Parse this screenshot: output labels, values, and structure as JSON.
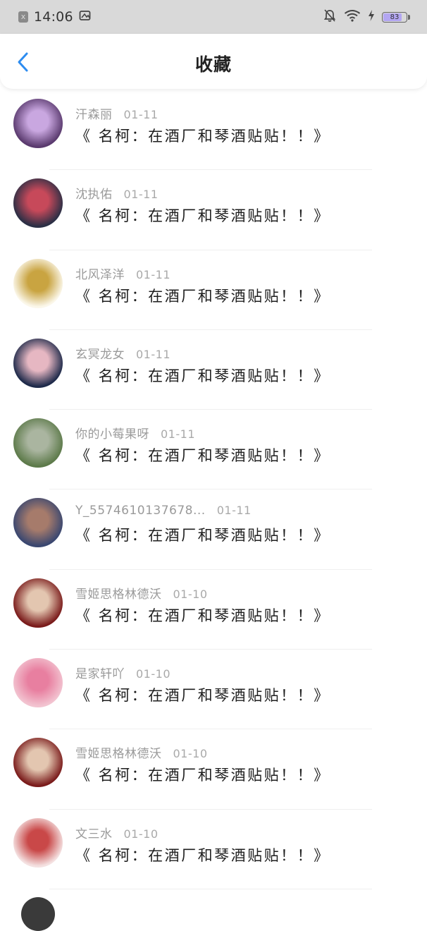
{
  "status_bar": {
    "time": "14:06",
    "sim_icon": "x",
    "battery": "83",
    "battery_fraction": 0.83,
    "icons": [
      "close-box-icon",
      "screenshot-icon",
      "bell-off-icon",
      "wifi-icon",
      "charging-icon",
      "battery-icon"
    ]
  },
  "header": {
    "title": "收藏",
    "back_icon": "chevron-left-icon",
    "accent": "#2d8cf0"
  },
  "items": [
    {
      "user": "汗森丽",
      "date": "01-11",
      "title": "《 名柯：在酒厂和琴酒贴贴！！》",
      "avatar": [
        "#5a3a6e",
        "#c9a7e0"
      ]
    },
    {
      "user": "沈执佑",
      "date": "01-11",
      "title": "《 名柯：在酒厂和琴酒贴贴！！》",
      "avatar": [
        "#2b2f45",
        "#c7495a"
      ]
    },
    {
      "user": "北风泽洋",
      "date": "01-11",
      "title": "《 名柯：在酒厂和琴酒贴贴！！》",
      "avatar": [
        "#fbf7ea",
        "#c9a441"
      ]
    },
    {
      "user": "玄冥龙女",
      "date": "01-11",
      "title": "《 名柯：在酒厂和琴酒贴贴！！》",
      "avatar": [
        "#1e2a4a",
        "#e6b7c2"
      ]
    },
    {
      "user": "你的小莓果呀",
      "date": "01-11",
      "title": "《 名柯：在酒厂和琴酒贴贴！！》",
      "avatar": [
        "#5d7a4a",
        "#aab5a0"
      ]
    },
    {
      "user": "Y_5574610137678...",
      "date": "01-11",
      "title": "《 名柯：在酒厂和琴酒贴贴！！》",
      "avatar": [
        "#3a4770",
        "#a67b6b"
      ]
    },
    {
      "user": "雪姬思格林德沃",
      "date": "01-10",
      "title": "《 名柯：在酒厂和琴酒贴贴！！》",
      "avatar": [
        "#7a1b1b",
        "#e3c6b0"
      ]
    },
    {
      "user": "是家轩吖",
      "date": "01-10",
      "title": "《 名柯：在酒厂和琴酒贴贴！！》",
      "avatar": [
        "#f2c3d0",
        "#e87fa0"
      ]
    },
    {
      "user": "雪姬思格林德沃",
      "date": "01-10",
      "title": "《 名柯：在酒厂和琴酒贴贴！！》",
      "avatar": [
        "#7a1b1b",
        "#e3c6b0"
      ]
    },
    {
      "user": "文三水",
      "date": "01-10",
      "title": "《 名柯：在酒厂和琴酒贴贴！！》",
      "avatar": [
        "#f4e1e1",
        "#c94848"
      ]
    }
  ]
}
